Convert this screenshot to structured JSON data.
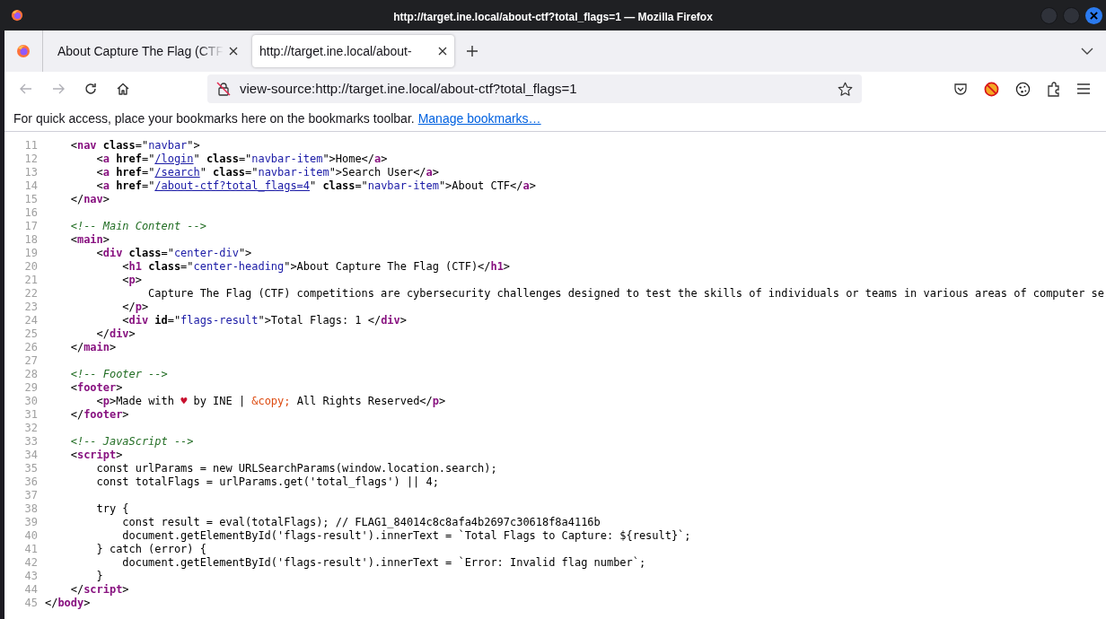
{
  "window": {
    "title": "http://target.ine.local/about-ctf?total_flags=1 — Mozilla Firefox"
  },
  "tabs": [
    {
      "label": "About Capture The Flag (CTF",
      "selected": false
    },
    {
      "label": "http://target.ine.local/about-",
      "selected": true
    }
  ],
  "nav_buttons": [
    {
      "kind": "back",
      "disabled": true
    },
    {
      "kind": "forward",
      "disabled": true
    },
    {
      "kind": "reload",
      "disabled": false
    },
    {
      "kind": "home",
      "disabled": false
    }
  ],
  "address_bar": {
    "value": "view-source:http://target.ine.local/about-ctf?total_flags=1"
  },
  "bookmarks_bar": {
    "message": "For quick access, place your bookmarks here on the bookmarks toolbar.",
    "link": "Manage bookmarks…"
  },
  "source_lines": [
    {
      "number": "11",
      "tokens": [
        {
          "kind": "text",
          "text": "    <"
        },
        {
          "kind": "tag",
          "text": "nav "
        },
        {
          "kind": "attr",
          "text": "class"
        },
        {
          "kind": "text",
          "text": "=\""
        },
        {
          "kind": "value",
          "text": "navbar"
        },
        {
          "kind": "text",
          "text": "\">"
        }
      ]
    },
    {
      "number": "12",
      "tokens": [
        {
          "kind": "text",
          "text": "        <"
        },
        {
          "kind": "tag",
          "text": "a "
        },
        {
          "kind": "attr",
          "text": "href"
        },
        {
          "kind": "text",
          "text": "=\""
        },
        {
          "kind": "link",
          "text": "/login"
        },
        {
          "kind": "text",
          "text": "\" "
        },
        {
          "kind": "attr",
          "text": "class"
        },
        {
          "kind": "text",
          "text": "=\""
        },
        {
          "kind": "value",
          "text": "navbar-item"
        },
        {
          "kind": "text",
          "text": "\">Home</"
        },
        {
          "kind": "tag",
          "text": "a"
        },
        {
          "kind": "text",
          "text": ">"
        }
      ]
    },
    {
      "number": "13",
      "tokens": [
        {
          "kind": "text",
          "text": "        <"
        },
        {
          "kind": "tag",
          "text": "a "
        },
        {
          "kind": "attr",
          "text": "href"
        },
        {
          "kind": "text",
          "text": "=\""
        },
        {
          "kind": "link",
          "text": "/search"
        },
        {
          "kind": "text",
          "text": "\" "
        },
        {
          "kind": "attr",
          "text": "class"
        },
        {
          "kind": "text",
          "text": "=\""
        },
        {
          "kind": "value",
          "text": "navbar-item"
        },
        {
          "kind": "text",
          "text": "\">Search User</"
        },
        {
          "kind": "tag",
          "text": "a"
        },
        {
          "kind": "text",
          "text": ">"
        }
      ]
    },
    {
      "number": "14",
      "tokens": [
        {
          "kind": "text",
          "text": "        <"
        },
        {
          "kind": "tag",
          "text": "a "
        },
        {
          "kind": "attr",
          "text": "href"
        },
        {
          "kind": "text",
          "text": "=\""
        },
        {
          "kind": "link",
          "text": "/about-ctf?total_flags=4"
        },
        {
          "kind": "text",
          "text": "\" "
        },
        {
          "kind": "attr",
          "text": "class"
        },
        {
          "kind": "text",
          "text": "=\""
        },
        {
          "kind": "value",
          "text": "navbar-item"
        },
        {
          "kind": "text",
          "text": "\">About CTF</"
        },
        {
          "kind": "tag",
          "text": "a"
        },
        {
          "kind": "text",
          "text": ">"
        }
      ]
    },
    {
      "number": "15",
      "tokens": [
        {
          "kind": "text",
          "text": "    </"
        },
        {
          "kind": "tag",
          "text": "nav"
        },
        {
          "kind": "text",
          "text": ">"
        }
      ]
    },
    {
      "number": "16"
    },
    {
      "number": "17",
      "tokens": [
        {
          "kind": "comment",
          "text": "    <!-- Main Content -->"
        }
      ]
    },
    {
      "number": "18",
      "tokens": [
        {
          "kind": "text",
          "text": "    <"
        },
        {
          "kind": "tag",
          "text": "main"
        },
        {
          "kind": "text",
          "text": ">"
        }
      ]
    },
    {
      "number": "19",
      "tokens": [
        {
          "kind": "text",
          "text": "        <"
        },
        {
          "kind": "tag",
          "text": "div "
        },
        {
          "kind": "attr",
          "text": "class"
        },
        {
          "kind": "text",
          "text": "=\""
        },
        {
          "kind": "value",
          "text": "center-div"
        },
        {
          "kind": "text",
          "text": "\">"
        }
      ]
    },
    {
      "number": "20",
      "tokens": [
        {
          "kind": "text",
          "text": "            <"
        },
        {
          "kind": "tag",
          "text": "h1 "
        },
        {
          "kind": "attr",
          "text": "class"
        },
        {
          "kind": "text",
          "text": "=\""
        },
        {
          "kind": "value",
          "text": "center-heading"
        },
        {
          "kind": "text",
          "text": "\">About Capture The Flag (CTF)</"
        },
        {
          "kind": "tag",
          "text": "h1"
        },
        {
          "kind": "text",
          "text": ">"
        }
      ]
    },
    {
      "number": "21",
      "tokens": [
        {
          "kind": "text",
          "text": "            <"
        },
        {
          "kind": "tag",
          "text": "p"
        },
        {
          "kind": "text",
          "text": ">"
        }
      ]
    },
    {
      "number": "22",
      "tokens": [
        {
          "kind": "text",
          "text": "                Capture The Flag (CTF) competitions are cybersecurity challenges designed to test the skills of individuals or teams in various areas of computer se"
        }
      ]
    },
    {
      "number": "23",
      "tokens": [
        {
          "kind": "text",
          "text": "            </"
        },
        {
          "kind": "tag",
          "text": "p"
        },
        {
          "kind": "text",
          "text": ">"
        }
      ]
    },
    {
      "number": "24",
      "tokens": [
        {
          "kind": "text",
          "text": "            <"
        },
        {
          "kind": "tag",
          "text": "div "
        },
        {
          "kind": "attr",
          "text": "id"
        },
        {
          "kind": "text",
          "text": "=\""
        },
        {
          "kind": "value",
          "text": "flags-result"
        },
        {
          "kind": "text",
          "text": "\">Total Flags: 1 </"
        },
        {
          "kind": "tag",
          "text": "div"
        },
        {
          "kind": "text",
          "text": ">"
        }
      ]
    },
    {
      "number": "25",
      "tokens": [
        {
          "kind": "text",
          "text": "        </"
        },
        {
          "kind": "tag",
          "text": "div"
        },
        {
          "kind": "text",
          "text": ">"
        }
      ]
    },
    {
      "number": "26",
      "tokens": [
        {
          "kind": "text",
          "text": "    </"
        },
        {
          "kind": "tag",
          "text": "main"
        },
        {
          "kind": "text",
          "text": ">"
        }
      ]
    },
    {
      "number": "27"
    },
    {
      "number": "28",
      "tokens": [
        {
          "kind": "comment",
          "text": "    <!-- Footer -->"
        }
      ]
    },
    {
      "number": "29",
      "tokens": [
        {
          "kind": "text",
          "text": "    <"
        },
        {
          "kind": "tag",
          "text": "footer"
        },
        {
          "kind": "text",
          "text": ">"
        }
      ]
    },
    {
      "number": "30",
      "tokens": [
        {
          "kind": "text",
          "text": "        <"
        },
        {
          "kind": "tag",
          "text": "p"
        },
        {
          "kind": "text",
          "text": ">Made with "
        },
        {
          "kind": "heart",
          "text": "♥"
        },
        {
          "kind": "text",
          "text": " by INE | "
        },
        {
          "kind": "entity",
          "text": "&copy;"
        },
        {
          "kind": "text",
          "text": " All Rights Reserved</"
        },
        {
          "kind": "tag",
          "text": "p"
        },
        {
          "kind": "text",
          "text": ">"
        }
      ]
    },
    {
      "number": "31",
      "tokens": [
        {
          "kind": "text",
          "text": "    </"
        },
        {
          "kind": "tag",
          "text": "footer"
        },
        {
          "kind": "text",
          "text": ">"
        }
      ]
    },
    {
      "number": "32"
    },
    {
      "number": "33",
      "tokens": [
        {
          "kind": "comment",
          "text": "    <!-- JavaScript -->"
        }
      ]
    },
    {
      "number": "34",
      "tokens": [
        {
          "kind": "text",
          "text": "    <"
        },
        {
          "kind": "tag",
          "text": "script"
        },
        {
          "kind": "text",
          "text": ">"
        }
      ]
    },
    {
      "number": "35",
      "tokens": [
        {
          "kind": "text",
          "text": "        const urlParams = new URLSearchParams(window.location.search);"
        }
      ]
    },
    {
      "number": "36",
      "tokens": [
        {
          "kind": "text",
          "text": "        const totalFlags = urlParams.get('total_flags') || 4;"
        }
      ]
    },
    {
      "number": "37"
    },
    {
      "number": "38",
      "tokens": [
        {
          "kind": "text",
          "text": "        try {"
        }
      ]
    },
    {
      "number": "39",
      "tokens": [
        {
          "kind": "text",
          "text": "            const result = eval(totalFlags); // FLAG1_84014c8c8afa4b2697c30618f8a4116b"
        }
      ]
    },
    {
      "number": "40",
      "tokens": [
        {
          "kind": "text",
          "text": "            document.getElementById('flags-result').innerText = `Total Flags to Capture: ${result}`;"
        }
      ]
    },
    {
      "number": "41",
      "tokens": [
        {
          "kind": "text",
          "text": "        } catch (error) {"
        }
      ]
    },
    {
      "number": "42",
      "tokens": [
        {
          "kind": "text",
          "text": "            document.getElementById('flags-result').innerText = `Error: Invalid flag number`;"
        }
      ]
    },
    {
      "number": "43",
      "tokens": [
        {
          "kind": "text",
          "text": "        }"
        }
      ]
    },
    {
      "number": "44",
      "tokens": [
        {
          "kind": "text",
          "text": "    </"
        },
        {
          "kind": "tag",
          "text": "script"
        },
        {
          "kind": "text",
          "text": ">"
        }
      ]
    },
    {
      "number": "45",
      "tokens": [
        {
          "kind": "text",
          "text": "</"
        },
        {
          "kind": "tag",
          "text": "body"
        },
        {
          "kind": "text",
          "text": ">"
        }
      ]
    }
  ]
}
